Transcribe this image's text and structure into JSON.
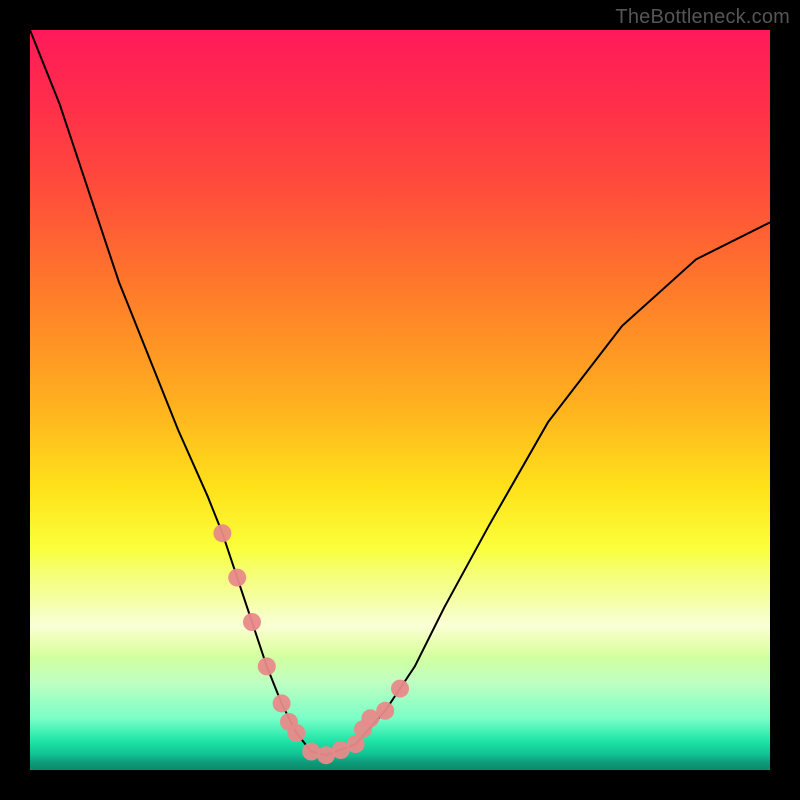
{
  "watermark": "TheBottleneck.com",
  "colors": {
    "background": "#000000",
    "curve_stroke": "#000000",
    "marker_fill": "#e88a8a",
    "gradient_top": "#ff1a5a",
    "gradient_mid": "#ffe21a",
    "gradient_bottom": "#0fbf91"
  },
  "chart_data": {
    "type": "line",
    "title": "",
    "xlabel": "",
    "ylabel": "",
    "xlim": [
      0,
      100
    ],
    "ylim": [
      0,
      100
    ],
    "x": [
      0,
      4,
      8,
      12,
      16,
      20,
      24,
      26,
      28,
      30,
      32,
      34,
      36,
      38,
      40,
      44,
      48,
      52,
      56,
      62,
      70,
      80,
      90,
      100
    ],
    "values": [
      100,
      90,
      78,
      66,
      56,
      46,
      37,
      32,
      26,
      20,
      14,
      9,
      5,
      2.5,
      2,
      3.5,
      8,
      14,
      22,
      33,
      47,
      60,
      69,
      74
    ],
    "series": [
      {
        "name": "bottleneck-curve",
        "x": [
          0,
          4,
          8,
          12,
          16,
          20,
          24,
          26,
          28,
          30,
          32,
          34,
          36,
          38,
          40,
          44,
          48,
          52,
          56,
          62,
          70,
          80,
          90,
          100
        ],
        "y": [
          100,
          90,
          78,
          66,
          56,
          46,
          37,
          32,
          26,
          20,
          14,
          9,
          5,
          2.5,
          2,
          3.5,
          8,
          14,
          22,
          33,
          47,
          60,
          69,
          74
        ]
      },
      {
        "name": "markers",
        "x": [
          26,
          28,
          30,
          32,
          34,
          35,
          36,
          38,
          40,
          42,
          44,
          45,
          46,
          48,
          50
        ],
        "y": [
          32,
          26,
          20,
          14,
          9,
          6.5,
          5,
          2.5,
          2,
          2.7,
          3.5,
          5.5,
          7,
          8,
          11
        ]
      }
    ]
  }
}
